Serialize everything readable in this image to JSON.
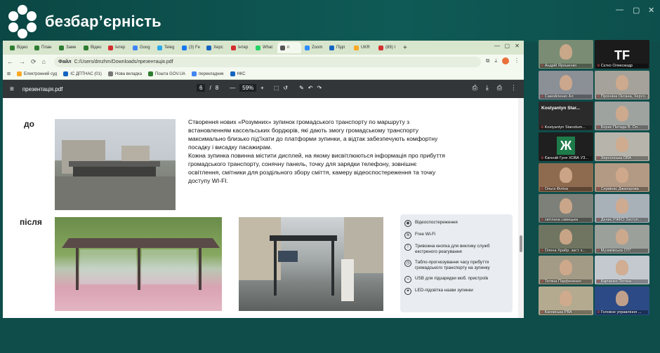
{
  "brand": {
    "name": "безбар’єрність"
  },
  "window_controls": [
    "—",
    "▢",
    "✕"
  ],
  "browser": {
    "tabs": [
      {
        "label": "Відео",
        "color": "#2e7d32"
      },
      {
        "label": "План",
        "color": "#2e7d32"
      },
      {
        "label": "Заме",
        "color": "#2e7d32"
      },
      {
        "label": "Відео",
        "color": "#2e7d32"
      },
      {
        "label": "Інтер",
        "color": "#d32f2f"
      },
      {
        "label": "Goog",
        "color": "#4285f4"
      },
      {
        "label": "Teleg",
        "color": "#29a9eb"
      },
      {
        "label": "(3) Fe",
        "color": "#1877f2"
      },
      {
        "label": "Херс",
        "color": "#1565c0"
      },
      {
        "label": "Інтер",
        "color": "#d32f2f"
      },
      {
        "label": "What",
        "color": "#25d366"
      },
      {
        "label": "п",
        "color": "#555555"
      },
      {
        "label": "Zoom",
        "color": "#2d8cff"
      },
      {
        "label": "Підп",
        "color": "#1565c0"
      },
      {
        "label": "UKR",
        "color": "#f9a825"
      },
      {
        "label": "(89) I",
        "color": "#d32f2f"
      }
    ],
    "new_tab": "+",
    "address": {
      "scheme": "Файл",
      "url": "C:/Users/dmzhm/Downloads/презентація.pdf"
    },
    "bookmarks": [
      {
        "label": "Електронний суд",
        "color": "#f9a825"
      },
      {
        "label": "ІС ДПТНАС (01)",
        "color": "#1565c0"
      },
      {
        "label": "Нова вкладка",
        "color": "#777777"
      },
      {
        "label": "Пошта GOV.UA",
        "color": "#2e7d32"
      },
      {
        "label": "перекладник",
        "color": "#4285f4"
      },
      {
        "label": "НКС",
        "color": "#1565c0"
      }
    ]
  },
  "pdf": {
    "filename": "презентація.pdf",
    "page_current": "6",
    "page_total": "8",
    "zoom": "59%",
    "minus": "—",
    "plus": "+"
  },
  "slide": {
    "label_before": "до",
    "label_after": "після",
    "paragraph": "Створення нових «Розумних» зупинок громадського транспорту по маршруту з\nвстановленням кассельських бордюрів, які дають змогу громадському транспорту\nмаксимально близько під'їхати до платформи зупинки, а відтак забезпечують комфортну\nпосадку і висадку пасажирам.\nКожна зупинка повинна містити дисплей, на якому висвітлюються інформація про прибуття\nгромадського транспорту, сонячну панель, точку для зарядки телефону, зовнішнє\nосвітлення, смітники для роздільного збору сміття, камеру відеоспостереження та точку\nдоступу WI-FI.",
    "features": [
      {
        "icon": "camera-icon",
        "glyph": "◉",
        "text": "Відеоспостереження"
      },
      {
        "icon": "wifi-icon",
        "glyph": "≋",
        "text": "Free Wi-Fi"
      },
      {
        "icon": "alarm-icon",
        "glyph": "!",
        "text": "Тривожна кнопка для виклику служб екстреного реагування"
      },
      {
        "icon": "clock-icon",
        "glyph": "◷",
        "text": "Табло-прогнозування часу прибуття громадського транспорту на зупинку"
      },
      {
        "icon": "usb-icon",
        "glyph": "⌁",
        "text": "USB для підзарядки моб. пристроїв"
      },
      {
        "icon": "bulb-icon",
        "glyph": "✦",
        "text": "LED-підсвітка назви зупинки"
      }
    ]
  },
  "participants": [
    {
      "name": "Андрій Ярошенко",
      "bg": "#7a8d74"
    },
    {
      "name": "Сєтко Олександр",
      "bg": "#1b1b1b",
      "big": "TF"
    },
    {
      "name": "Самойленко Ал",
      "bg": "#8b8f96"
    },
    {
      "name": "Прохніна Оксана, Херсо...",
      "bg": "#a4a29a"
    },
    {
      "name": "Kostyantyn Starodum...",
      "bg": "#2b2b2b",
      "title": "Kostyantyn Star..."
    },
    {
      "name": "Борис Питида В. Ол...",
      "bg": "#9fa3a0"
    },
    {
      "name": "Євгеній Гуня ХОВА УЗ...",
      "bg": "#1f1f1f",
      "big": "Ж",
      "green": true
    },
    {
      "name": "Херсонська ОВА",
      "bg": "#b7b4ab"
    },
    {
      "name": "Ольга Філіна",
      "bg": "#8e6b4f"
    },
    {
      "name": "Сервінас Джапарова",
      "bg": "#b39a84"
    },
    {
      "name": "світлана савицька",
      "bg": "#7c8079"
    },
    {
      "name": "Денис РЖКО Заступ...",
      "bg": "#a9b1b8"
    },
    {
      "name": "Олена Храбр. заст. к...",
      "bg": "#6f7561"
    },
    {
      "name": "Музиківська ОТГ",
      "bg": "#9ca09b"
    },
    {
      "name": "Тетяна Парфененко",
      "bg": "#a39b86"
    },
    {
      "name": "Карченко Тетяна",
      "bg": "#c3c9cf"
    },
    {
      "name": "Каховська РВА",
      "bg": "#b3aa90"
    },
    {
      "name": "Головне управління ...",
      "bg": "#2c4b86"
    }
  ]
}
